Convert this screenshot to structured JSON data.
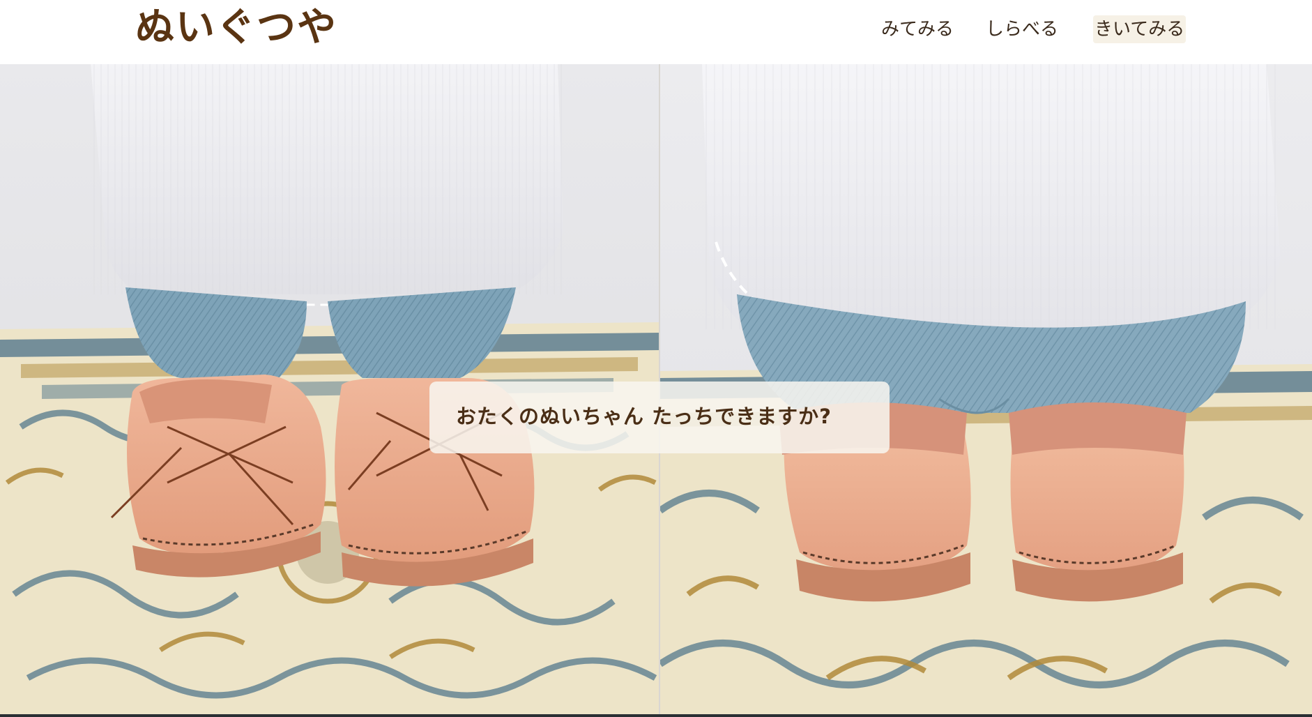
{
  "header": {
    "logo_text": "ぬいぐつや",
    "nav": [
      {
        "label": "みてみる"
      },
      {
        "label": "しらべる"
      },
      {
        "label": "きいてみる"
      }
    ]
  },
  "hero": {
    "caption": "おたくのぬいちゃん たっちできますか?"
  },
  "colors": {
    "brand": "#5a3412",
    "nav_text": "#3a2a1c",
    "active_nav_bg": "#f6f1e6",
    "shoe_leather": "#e8a88a",
    "denim": "#7fa3b8",
    "shirt": "#f2f2f4",
    "rug_cream": "#ede4c8",
    "rug_blue": "#5e7f90",
    "rug_gold": "#b08a3a"
  }
}
